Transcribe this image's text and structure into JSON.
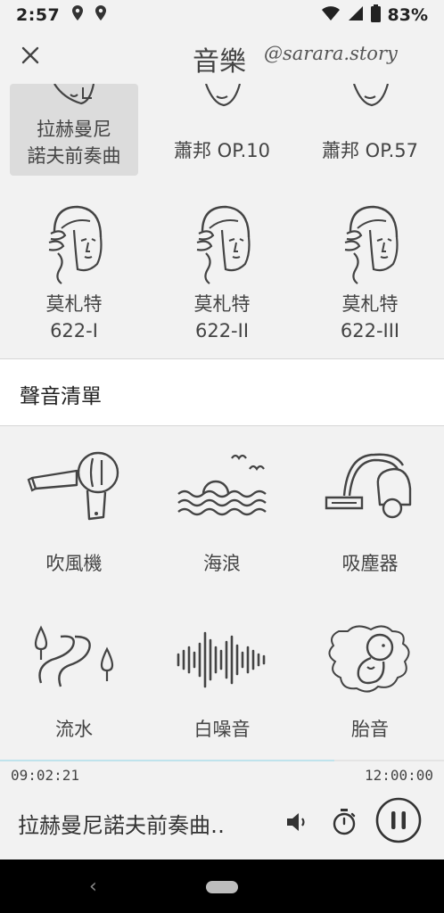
{
  "status_bar": {
    "time": "2:57",
    "battery": "83%"
  },
  "header": {
    "title": "音樂",
    "watermark": "@sarara.story"
  },
  "music_items": [
    {
      "label_lines": [
        "拉赫曼尼",
        "諾夫前奏曲"
      ],
      "icon": "composer-portrait-icon",
      "selected": true
    },
    {
      "label_lines": [
        "蕭邦 OP.10"
      ],
      "icon": "composer-portrait-icon"
    },
    {
      "label_lines": [
        "蕭邦 OP.57"
      ],
      "icon": "composer-portrait-icon"
    },
    {
      "label_lines": [
        "莫札特",
        "622-I"
      ],
      "icon": "mozart-portrait-icon"
    },
    {
      "label_lines": [
        "莫札特",
        "622-II"
      ],
      "icon": "mozart-portrait-icon"
    },
    {
      "label_lines": [
        "莫札特",
        "622-III"
      ],
      "icon": "mozart-portrait-icon"
    }
  ],
  "sound_section": {
    "title": "聲音清單"
  },
  "sounds": [
    {
      "label": "吹風機",
      "icon": "hair-dryer-icon"
    },
    {
      "label": "海浪",
      "icon": "ocean-waves-icon"
    },
    {
      "label": "吸塵器",
      "icon": "vacuum-cleaner-icon"
    },
    {
      "label": "流水",
      "icon": "flowing-water-icon"
    },
    {
      "label": "白噪音",
      "icon": "white-noise-icon"
    },
    {
      "label": "胎音",
      "icon": "fetus-icon"
    }
  ],
  "player": {
    "elapsed": "09:02:21",
    "total": "12:00:00",
    "progress": 0.7536,
    "now_playing": "拉赫曼尼諾夫前奏曲‥"
  },
  "colors": {
    "accent_progress": "#bfe3ec",
    "selected_tile": "#dcdcdc",
    "nav_bar": "#000000"
  }
}
